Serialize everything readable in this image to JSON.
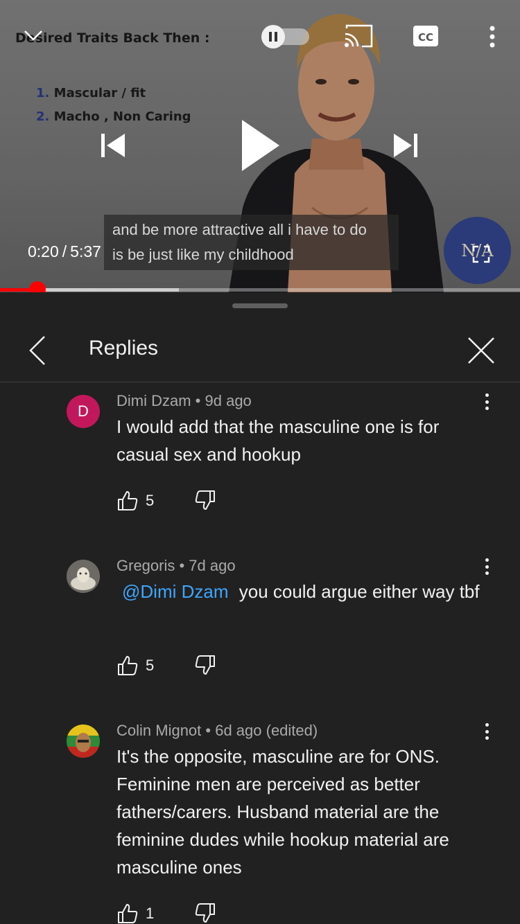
{
  "video": {
    "slide_title": "Desired Traits Back Then :",
    "slide_items": [
      {
        "num": "1.",
        "text": "Mascular / fit"
      },
      {
        "num": "2.",
        "text": "Macho , Non Caring"
      }
    ],
    "caption_line1": "and be more attractive all i have to do",
    "caption_line2": "is be just like my childhood",
    "current_time": "0:20",
    "separator": "/",
    "duration": "5:37",
    "channel_logo_text": "N/A",
    "progress_played": 0.072,
    "progress_buffered": 0.344
  },
  "icons": {
    "collapse": "chevron-down-icon",
    "autoplay": "autoplay-toggle-icon",
    "cast": "cast-icon",
    "captions": "closed-captions-icon",
    "more": "more-vertical-icon",
    "previous": "skip-previous-icon",
    "play": "play-icon",
    "next": "skip-next-icon",
    "fullscreen": "fullscreen-icon",
    "back": "chevron-left-icon",
    "close": "close-icon",
    "like": "thumbs-up-icon",
    "dislike": "thumbs-down-icon"
  },
  "captions_label": "CC",
  "panel": {
    "title": "Replies"
  },
  "comments": [
    {
      "author": "Dimi Dzam",
      "time": "9d ago",
      "avatar_letter": "D",
      "avatar_color": "#c2185b",
      "mention": "",
      "text": "I would add that the masculine one is for casual sex and hookup",
      "likes": "5"
    },
    {
      "author": "Gregoris",
      "time": "7d ago",
      "mention": "@Dimi Dzam",
      "text": "you could argue either way tbf",
      "likes": "5"
    },
    {
      "author": "Colin Mignot",
      "time": "6d ago (edited)",
      "mention": "",
      "text": "It's the opposite, masculine are for ONS. Feminine men are perceived as better fathers/carers. Husband material are the feminine dudes while hookup material are masculine ones",
      "likes": "1"
    }
  ],
  "colors": {
    "accent_red": "#ff0000",
    "mention_blue": "#3ea6ff",
    "background": "#212121"
  }
}
